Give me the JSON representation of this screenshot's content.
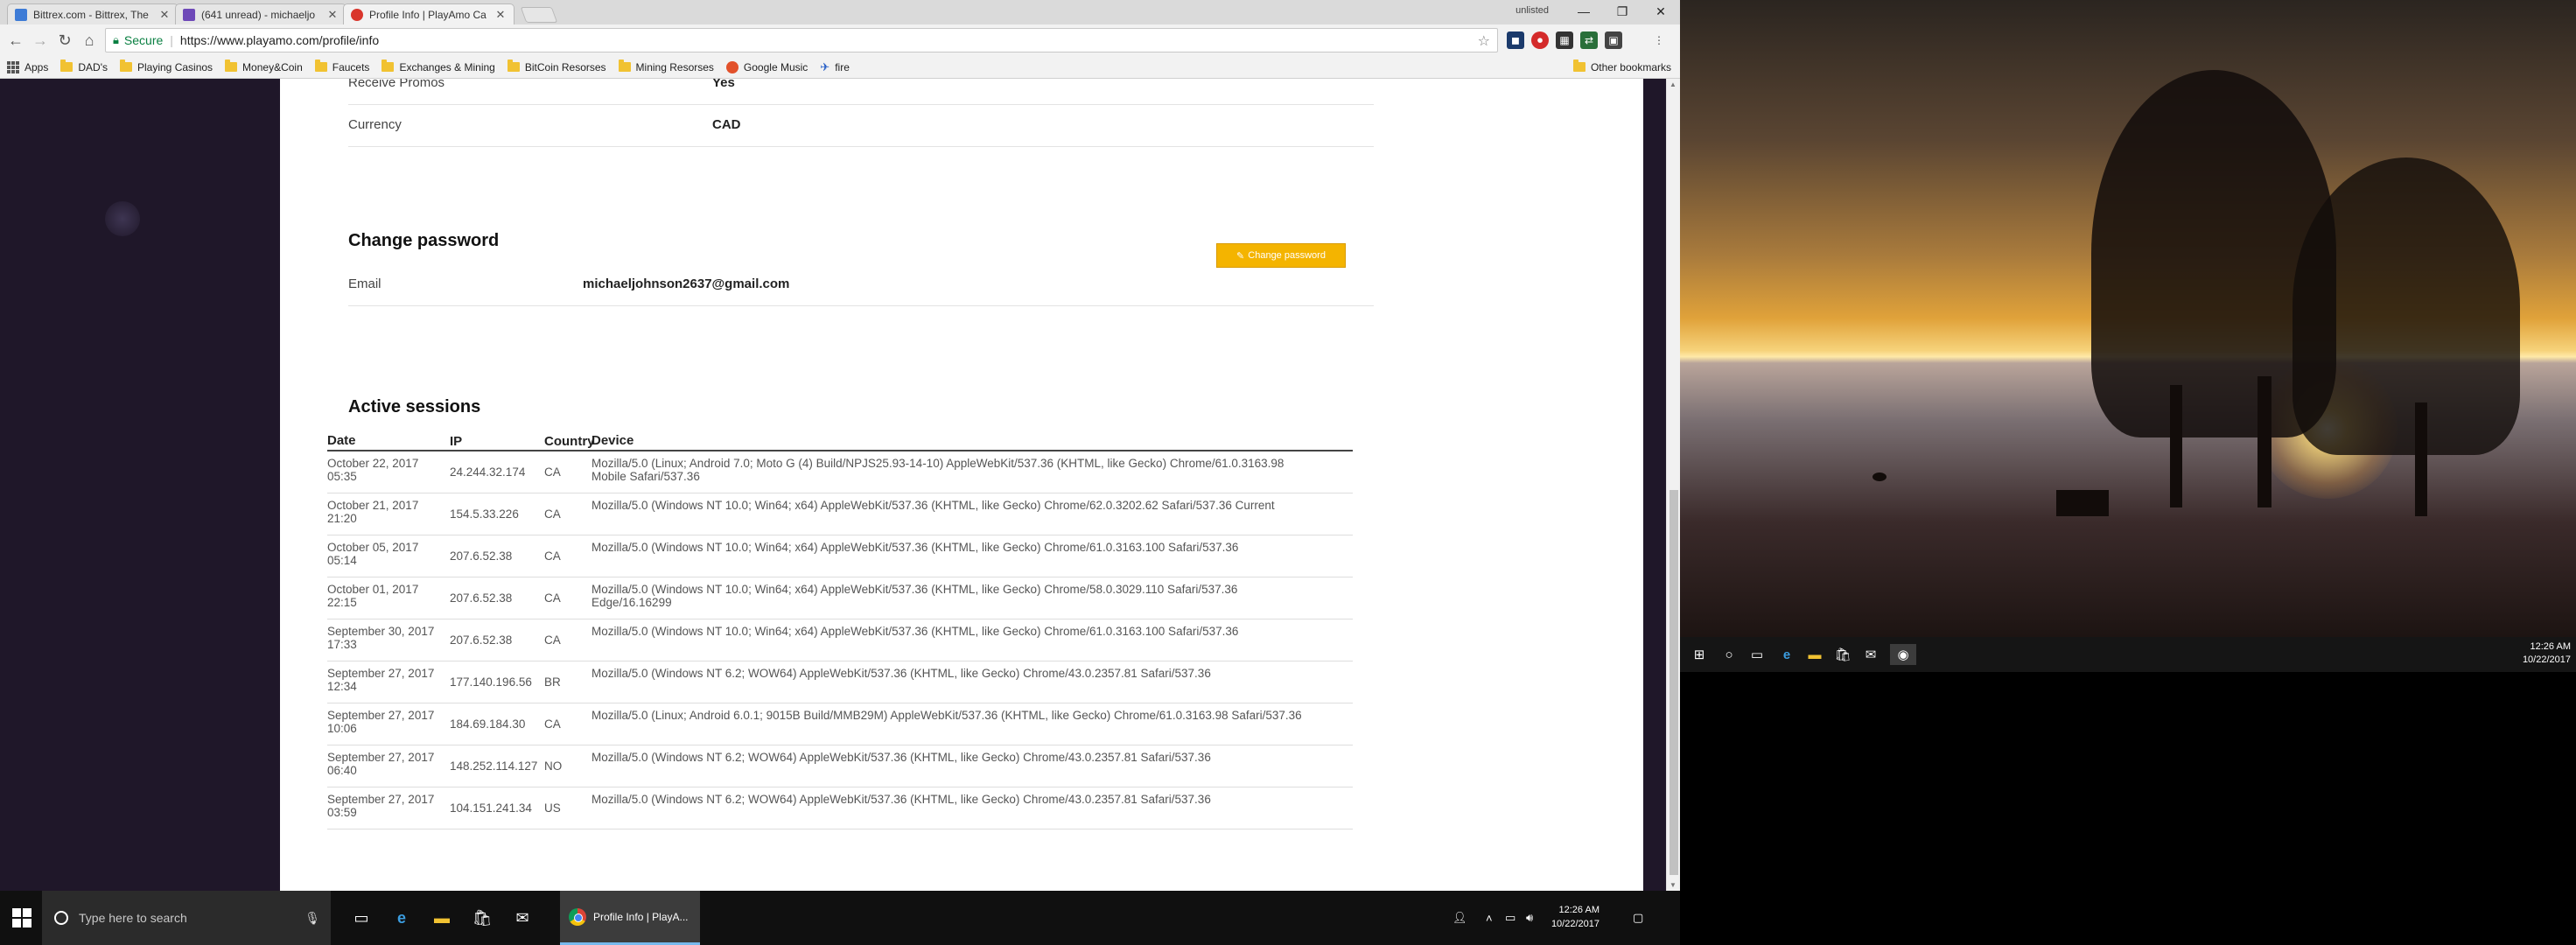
{
  "browser": {
    "tabs": [
      {
        "title": "Bittrex.com - Bittrex, The",
        "favicon_color": "#3d7bd6"
      },
      {
        "title": "(641 unread) - michaeljo",
        "favicon_color": "#6e49b8"
      },
      {
        "title": "Profile Info | PlayAmo Ca",
        "favicon_color": "#d9362c",
        "active": true
      }
    ],
    "profile_label": "unlisted",
    "window_controls": {
      "minimize": "—",
      "restore": "❐",
      "close": "✕"
    },
    "nav": {
      "back": "←",
      "forward": "→",
      "reload": "↻",
      "home": "⌂"
    },
    "omnibox": {
      "secure_label": "Secure",
      "url": "https://www.playamo.com/profile/info"
    },
    "bookmarks": [
      {
        "label": "Apps",
        "type": "apps"
      },
      {
        "label": "DAD's",
        "type": "folder"
      },
      {
        "label": "Playing Casinos",
        "type": "folder"
      },
      {
        "label": "Money&Coin",
        "type": "folder"
      },
      {
        "label": "Faucets",
        "type": "folder"
      },
      {
        "label": "Exchanges & Mining",
        "type": "folder"
      },
      {
        "label": "BitCoin Resorses",
        "type": "folder"
      },
      {
        "label": "Mining Resorses",
        "type": "folder"
      },
      {
        "label": "Google Music",
        "type": "circle"
      },
      {
        "label": "fire",
        "type": "fire"
      }
    ],
    "other_bookmarks": "Other bookmarks"
  },
  "profile": {
    "rows": [
      {
        "label": "Receive Promos",
        "value": "Yes"
      },
      {
        "label": "Currency",
        "value": "CAD"
      }
    ],
    "change_password": {
      "title": "Change password",
      "button_label": "Change password",
      "email_label": "Email",
      "email_value": "michaeljohnson2637@gmail.com"
    }
  },
  "sessions": {
    "title": "Active sessions",
    "columns": [
      "Date",
      "IP",
      "Country",
      "Device"
    ],
    "rows": [
      {
        "date": "October 22, 2017 05:35",
        "ip": "24.244.32.174",
        "country": "CA",
        "device": "Mozilla/5.0 (Linux; Android 7.0; Moto G (4) Build/NPJS25.93-14-10) AppleWebKit/537.36 (KHTML, like Gecko) Chrome/61.0.3163.98 Mobile Safari/537.36"
      },
      {
        "date": "October 21, 2017 21:20",
        "ip": "154.5.33.226",
        "country": "CA",
        "device": "Mozilla/5.0 (Windows NT 10.0; Win64; x64) AppleWebKit/537.36 (KHTML, like Gecko) Chrome/62.0.3202.62 Safari/537.36 Current"
      },
      {
        "date": "October 05, 2017 05:14",
        "ip": "207.6.52.38",
        "country": "CA",
        "device": "Mozilla/5.0 (Windows NT 10.0; Win64; x64) AppleWebKit/537.36 (KHTML, like Gecko) Chrome/61.0.3163.100 Safari/537.36"
      },
      {
        "date": "October 01, 2017 22:15",
        "ip": "207.6.52.38",
        "country": "CA",
        "device": "Mozilla/5.0 (Windows NT 10.0; Win64; x64) AppleWebKit/537.36 (KHTML, like Gecko) Chrome/58.0.3029.110 Safari/537.36 Edge/16.16299"
      },
      {
        "date": "September 30, 2017 17:33",
        "ip": "207.6.52.38",
        "country": "CA",
        "device": "Mozilla/5.0 (Windows NT 10.0; Win64; x64) AppleWebKit/537.36 (KHTML, like Gecko) Chrome/61.0.3163.100 Safari/537.36"
      },
      {
        "date": "September 27, 2017 12:34",
        "ip": "177.140.196.56",
        "country": "BR",
        "device": "Mozilla/5.0 (Windows NT 6.2; WOW64) AppleWebKit/537.36 (KHTML, like Gecko) Chrome/43.0.2357.81 Safari/537.36"
      },
      {
        "date": "September 27, 2017 10:06",
        "ip": "184.69.184.30",
        "country": "CA",
        "device": "Mozilla/5.0 (Linux; Android 6.0.1; 9015B Build/MMB29M) AppleWebKit/537.36 (KHTML, like Gecko) Chrome/61.0.3163.98 Safari/537.36"
      },
      {
        "date": "September 27, 2017 06:40",
        "ip": "148.252.114.127",
        "country": "NO",
        "device": "Mozilla/5.0 (Windows NT 6.2; WOW64) AppleWebKit/537.36 (KHTML, like Gecko) Chrome/43.0.2357.81 Safari/537.36"
      },
      {
        "date": "September 27, 2017 03:59",
        "ip": "104.151.241.34",
        "country": "US",
        "device": "Mozilla/5.0 (Windows NT 6.2; WOW64) AppleWebKit/537.36 (KHTML, like Gecko) Chrome/43.0.2357.81 Safari/537.36"
      }
    ]
  },
  "taskbar_left": {
    "search_placeholder": "Type here to search",
    "active_app_label": "Profile Info | PlayA...",
    "time": "12:26 AM",
    "date": "10/22/2017"
  },
  "taskbar_right": {
    "time": "12:26 AM",
    "date": "10/22/2017"
  }
}
